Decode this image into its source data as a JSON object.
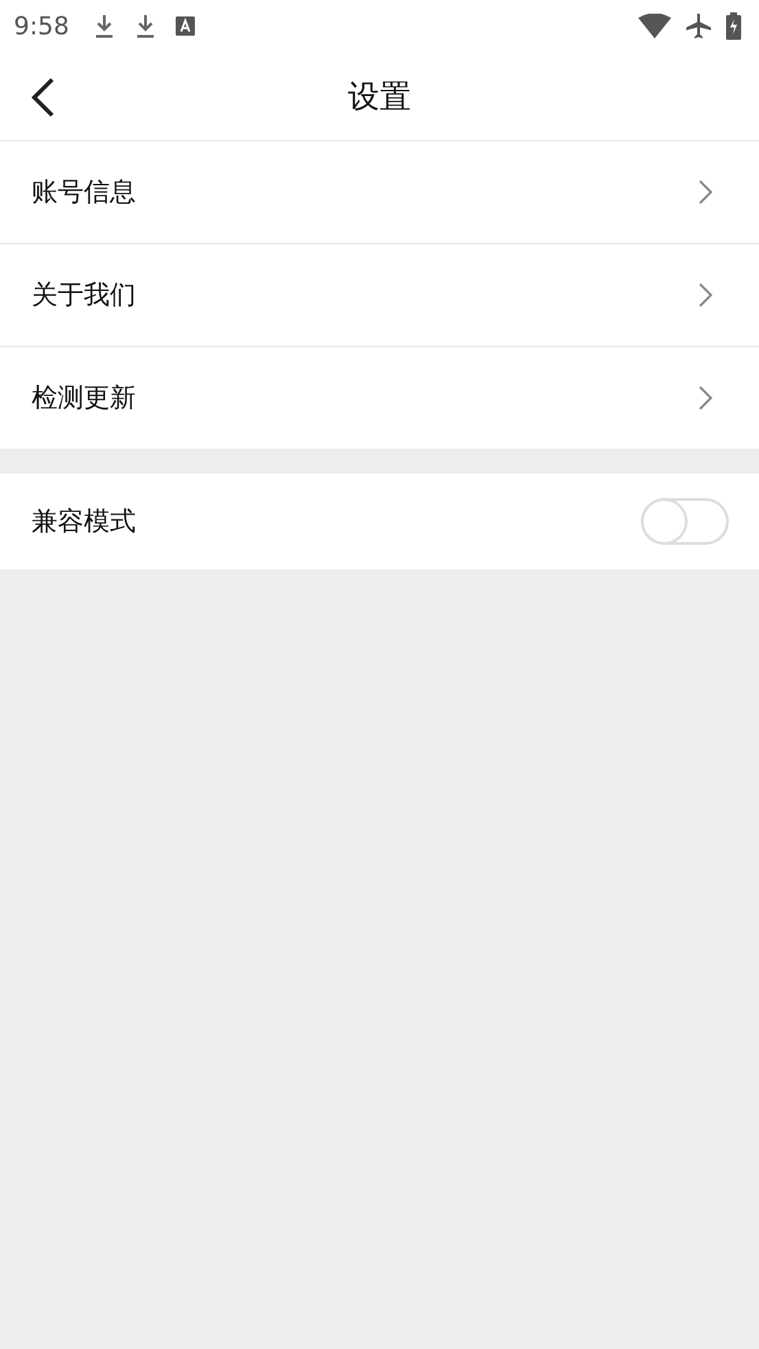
{
  "status_bar": {
    "time": "9:58"
  },
  "header": {
    "title": "设置"
  },
  "groups": [
    {
      "items": [
        {
          "kind": "link",
          "label": "账号信息"
        },
        {
          "kind": "link",
          "label": "关于我们"
        },
        {
          "kind": "link",
          "label": "检测更新"
        }
      ]
    },
    {
      "items": [
        {
          "kind": "switch",
          "label": "兼容模式",
          "on": false
        }
      ]
    }
  ]
}
